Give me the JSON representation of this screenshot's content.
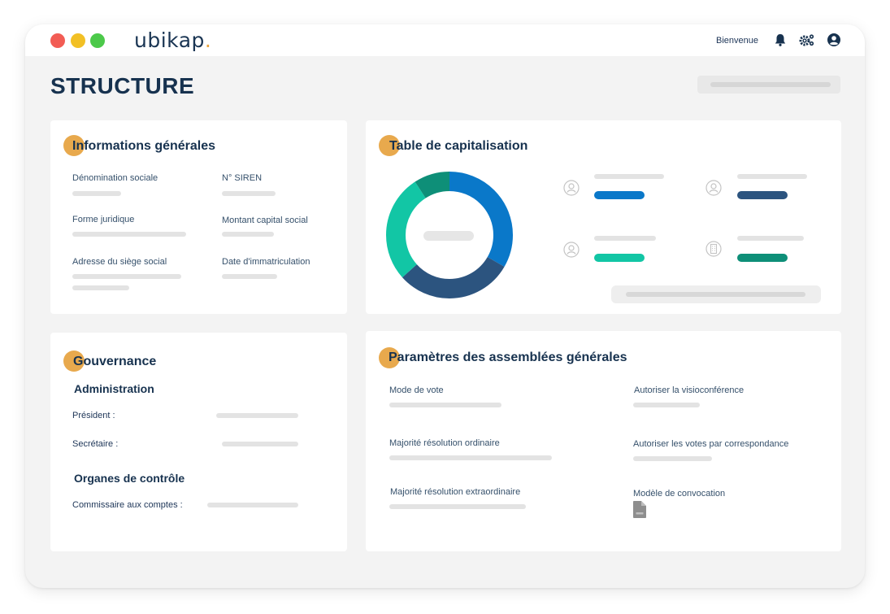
{
  "app": {
    "logo": "ubikap",
    "logo_dot": ".",
    "welcome": "Bienvenue",
    "icons": [
      "bell-icon",
      "gears-icon",
      "user-circle-icon"
    ]
  },
  "page": {
    "title": "STRUCTURE"
  },
  "general_info": {
    "title": "Informations générales",
    "fields": {
      "denomination": "Dénomination sociale",
      "siren": "N° SIREN",
      "legal_form": "Forme juridique",
      "capital": "Montant capital social",
      "address": "Adresse du siège social",
      "registration_date": "Date d'immatriculation"
    }
  },
  "cap_table": {
    "title": "Table de capitalisation",
    "colors": {
      "blue": "#0a78c9",
      "navy": "#2c547f",
      "teal": "#12c6a5",
      "green": "#0e8f78"
    },
    "icons": [
      "user-icon",
      "user-icon",
      "user-icon",
      "building-icon"
    ]
  },
  "governance": {
    "title": "Gouvernance",
    "administration": "Administration",
    "president": "Président :",
    "secretary": "Secrétaire :",
    "control_bodies": "Organes de contrôle",
    "auditor": "Commissaire aux comptes :"
  },
  "assemblies": {
    "title": "Paramètres des assemblées générales",
    "vote_mode": "Mode de vote",
    "visio": "Autoriser la visioconférence",
    "ordinary_majority": "Majorité résolution ordinaire",
    "correspondence": "Autoriser les votes par correspondance",
    "extraordinary_majority": "Majorité résolution extraordinaire",
    "template": "Modèle de convocation",
    "template_icon": "pdf-file-icon"
  },
  "colors": {
    "accent": "#e8a94d",
    "dot_red": "#f25c54",
    "dot_yellow": "#f2c025",
    "dot_green": "#4cc94a"
  }
}
